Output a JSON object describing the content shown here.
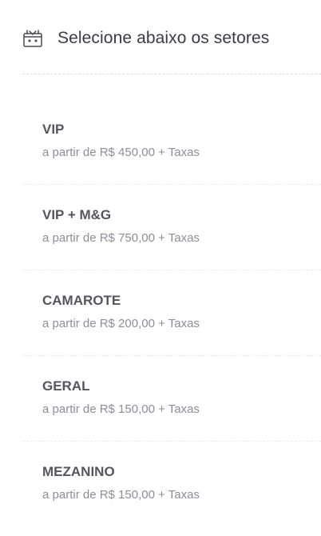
{
  "header": {
    "icon": "ticket-basket-icon",
    "title": "Selecione abaixo os setores"
  },
  "sectors": [
    {
      "name": "VIP",
      "price": "a partir de R$ 450,00 + Taxas"
    },
    {
      "name": "VIP + M&G",
      "price": "a partir de R$ 750,00 + Taxas"
    },
    {
      "name": "CAMAROTE",
      "price": "a partir de R$ 200,00 + Taxas"
    },
    {
      "name": "GERAL",
      "price": "a partir de R$ 150,00 + Taxas"
    },
    {
      "name": "MEZANINO",
      "price": "a partir de R$ 150,00 + Taxas"
    }
  ],
  "colors": {
    "title": "#3b3b45",
    "sector_name": "#55555f",
    "sector_price": "#8e8e99",
    "divider": "#dedee3"
  }
}
